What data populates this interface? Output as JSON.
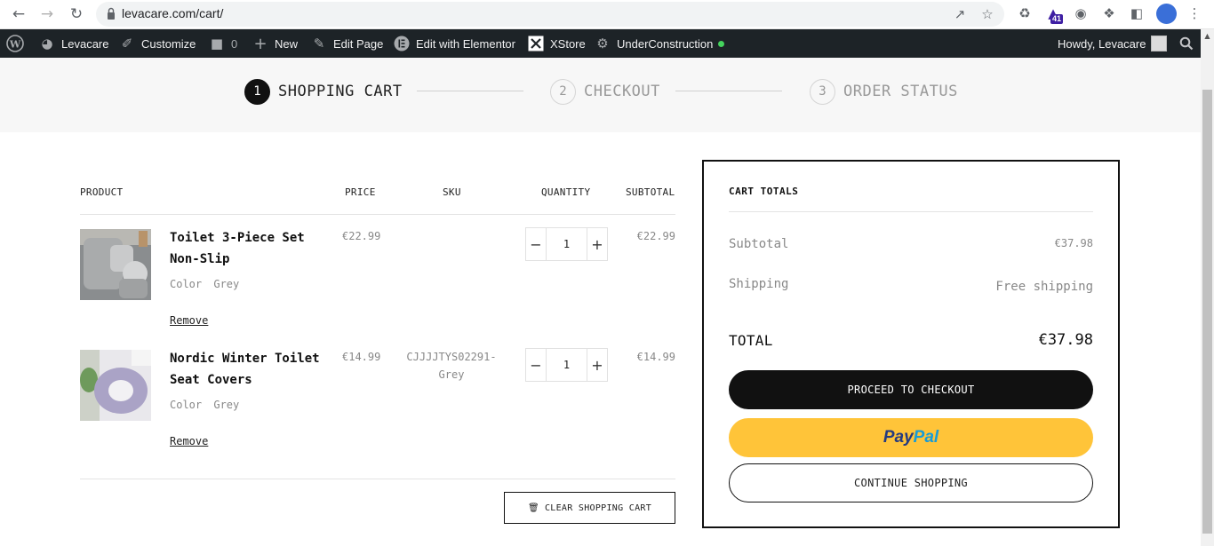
{
  "browser": {
    "url": "levacare.com/cart/",
    "extension_badge": "41"
  },
  "adminbar": {
    "site_name": "Levacare",
    "customize": "Customize",
    "comments_count": "0",
    "new": "New",
    "edit_page": "Edit Page",
    "edit_elementor": "Edit with Elementor",
    "xstore": "XStore",
    "under_construction": "UnderConstruction",
    "howdy": "Howdy, Levacare"
  },
  "steps": [
    {
      "num": "1",
      "label": "SHOPPING CART",
      "active": true
    },
    {
      "num": "2",
      "label": "CHECKOUT",
      "active": false
    },
    {
      "num": "3",
      "label": "ORDER STATUS",
      "active": false
    }
  ],
  "cart": {
    "headers": {
      "product": "PRODUCT",
      "price": "PRICE",
      "sku": "SKU",
      "quantity": "QUANTITY",
      "subtotal": "SUBTOTAL"
    },
    "items": [
      {
        "name": "Toilet 3-Piece Set Non-Slip",
        "attr_label": "Color",
        "attr_value": "Grey",
        "remove": "Remove",
        "price": "€22.99",
        "sku": "",
        "qty": "1",
        "subtotal": "€22.99"
      },
      {
        "name": "Nordic Winter Toilet Seat Covers",
        "attr_label": "Color",
        "attr_value": "Grey",
        "remove": "Remove",
        "price": "€14.99",
        "sku": "CJJJJTYS02291-Grey",
        "qty": "1",
        "subtotal": "€14.99"
      }
    ],
    "clear_label": "CLEAR SHOPPING CART"
  },
  "totals": {
    "title": "CART TOTALS",
    "subtotal_label": "Subtotal",
    "subtotal_value": "€37.98",
    "shipping_label": "Shipping",
    "shipping_value": "Free shipping",
    "total_label": "TOTAL",
    "total_value": "€37.98",
    "checkout_label": "PROCEED TO CHECKOUT",
    "paypal_a": "Pay",
    "paypal_b": "Pal",
    "continue_label": "CONTINUE SHOPPING"
  },
  "colors": {
    "adminbar": "#1d2327",
    "accent_dark": "#111111",
    "paypal_yellow": "#ffc439",
    "status_dot": "#44d35d"
  }
}
